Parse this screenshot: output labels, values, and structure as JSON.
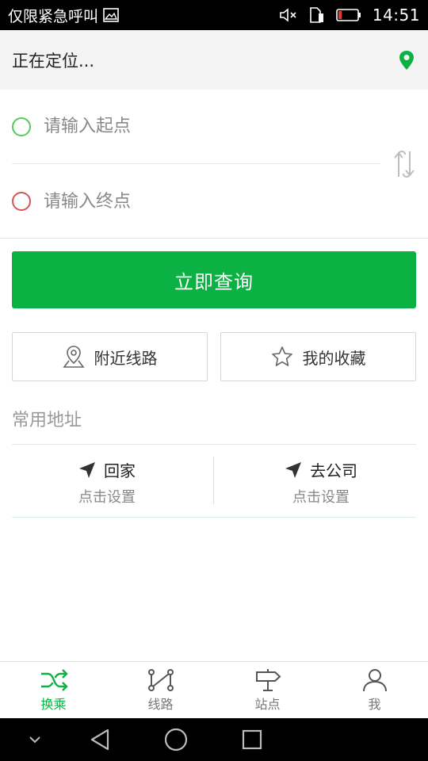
{
  "status_bar": {
    "carrier": "仅限紧急呼叫",
    "time": "14:51",
    "icons": [
      "image-icon",
      "mute-icon",
      "sim-icon",
      "battery-icon"
    ]
  },
  "location": {
    "text": "正在定位...",
    "icon": "location-pin-icon",
    "color": "#0bb143"
  },
  "route": {
    "start_placeholder": "请输入起点",
    "end_placeholder": "请输入终点",
    "start_color": "#5ac85c",
    "end_color": "#d75454",
    "swap_icon": "swap-icon"
  },
  "query_button": {
    "label": "立即查询",
    "color": "#0bb143"
  },
  "actions": {
    "nearby": {
      "label": "附近线路",
      "icon": "map-pin-outline-icon"
    },
    "favorites": {
      "label": "我的收藏",
      "icon": "star-outline-icon"
    }
  },
  "common_address": {
    "title": "常用地址",
    "items": [
      {
        "name": "回家",
        "sub": "点击设置",
        "icon": "navigation-arrow-icon"
      },
      {
        "name": "去公司",
        "sub": "点击设置",
        "icon": "navigation-arrow-icon"
      }
    ]
  },
  "tabs": [
    {
      "label": "换乘",
      "icon": "shuffle-icon",
      "active": true
    },
    {
      "label": "线路",
      "icon": "route-icon",
      "active": false
    },
    {
      "label": "站点",
      "icon": "signpost-icon",
      "active": false
    },
    {
      "label": "我",
      "icon": "person-icon",
      "active": false
    }
  ],
  "system_nav": [
    "chevron-down-icon",
    "back-icon",
    "home-icon",
    "recents-icon"
  ]
}
